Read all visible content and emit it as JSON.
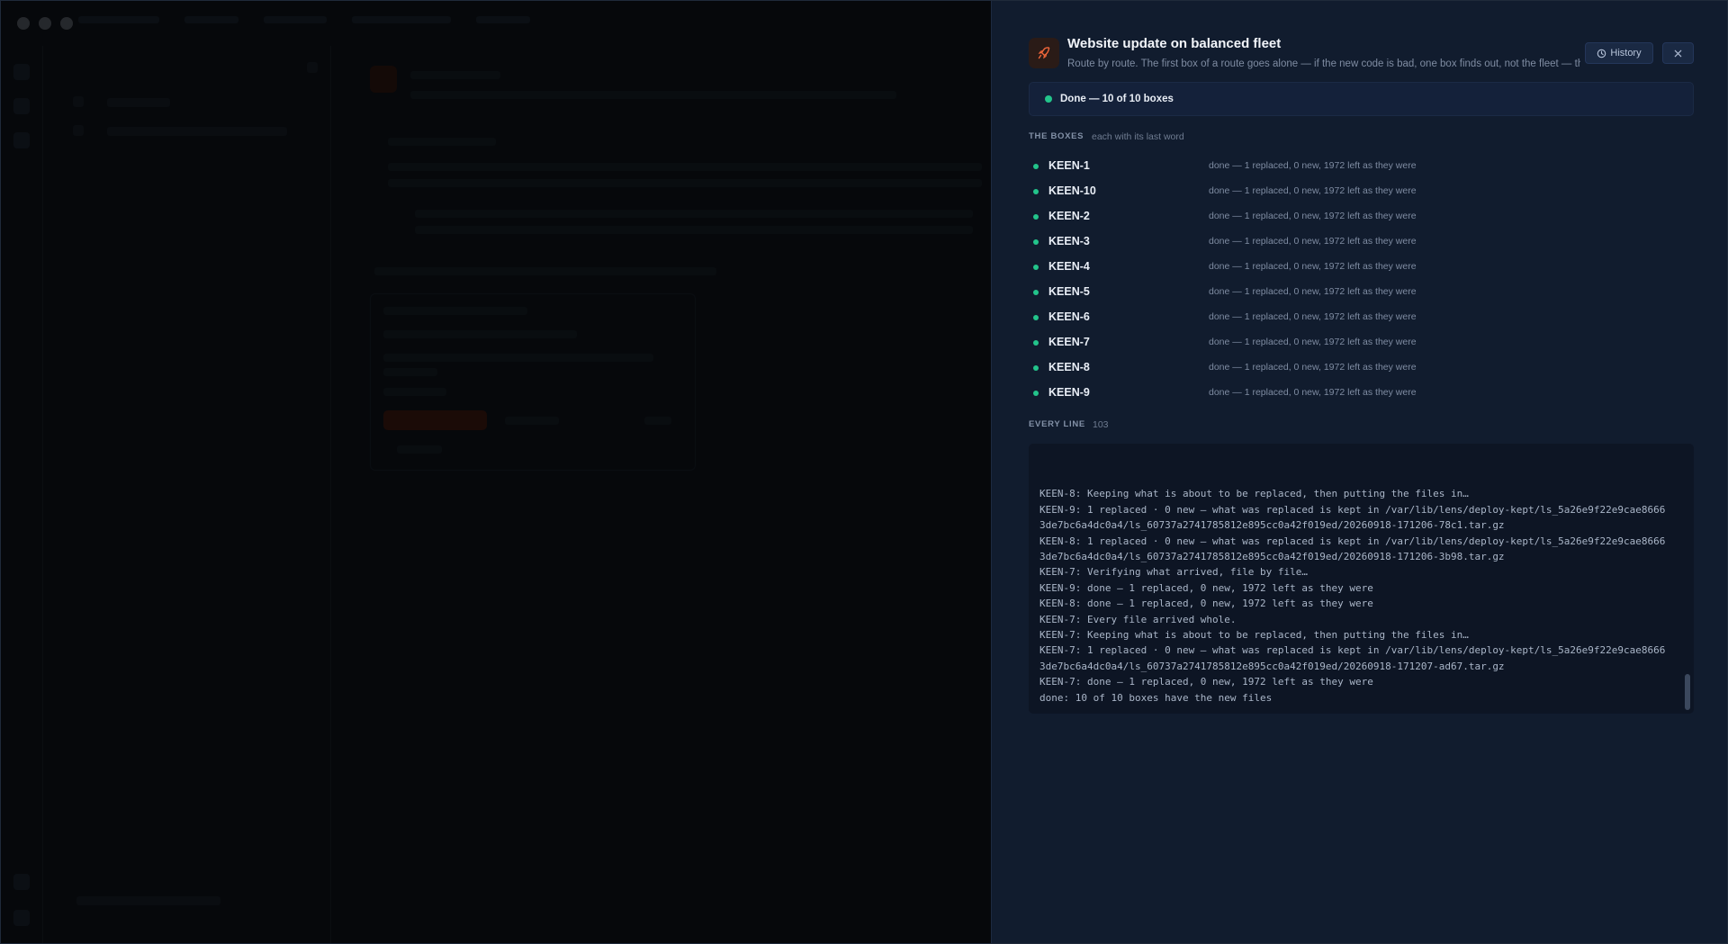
{
  "panel": {
    "title": "Website update on balanced fleet",
    "subtitle": "Route by route. The first box of a route goes alone — if the new code is bad, one box finds out, not the fleet — the",
    "history_label": "History",
    "icon": "rocket-icon",
    "close_icon": "close-icon",
    "status": {
      "text": "Done — 10 of 10 boxes",
      "color": "#23c48b"
    },
    "boxes_section": {
      "label": "THE BOXES",
      "sublabel": "each with its last word"
    },
    "boxes": [
      {
        "name": "KEEN-1",
        "note": "done — 1 replaced, 0 new, 1972 left as they were"
      },
      {
        "name": "KEEN-10",
        "note": "done — 1 replaced, 0 new, 1972 left as they were"
      },
      {
        "name": "KEEN-2",
        "note": "done — 1 replaced, 0 new, 1972 left as they were"
      },
      {
        "name": "KEEN-3",
        "note": "done — 1 replaced, 0 new, 1972 left as they were"
      },
      {
        "name": "KEEN-4",
        "note": "done — 1 replaced, 0 new, 1972 left as they were"
      },
      {
        "name": "KEEN-5",
        "note": "done — 1 replaced, 0 new, 1972 left as they were"
      },
      {
        "name": "KEEN-6",
        "note": "done — 1 replaced, 0 new, 1972 left as they were"
      },
      {
        "name": "KEEN-7",
        "note": "done — 1 replaced, 0 new, 1972 left as they were"
      },
      {
        "name": "KEEN-8",
        "note": "done — 1 replaced, 0 new, 1972 left as they were"
      },
      {
        "name": "KEEN-9",
        "note": "done — 1 replaced, 0 new, 1972 left as they were"
      }
    ],
    "lines_section": {
      "label": "EVERY LINE",
      "count": "103"
    },
    "log": [
      "KEEN-8: Keeping what is about to be replaced, then putting the files in…",
      "KEEN-9: 1 replaced · 0 new — what was replaced is kept in /var/lib/lens/deploy-kept/ls_5a26e9f22e9cae86663de7bc6a4dc0a4/ls_60737a2741785812e895cc0a42f019ed/20260918-171206-78c1.tar.gz",
      "KEEN-8: 1 replaced · 0 new — what was replaced is kept in /var/lib/lens/deploy-kept/ls_5a26e9f22e9cae86663de7bc6a4dc0a4/ls_60737a2741785812e895cc0a42f019ed/20260918-171206-3b98.tar.gz",
      "KEEN-7: Verifying what arrived, file by file…",
      "KEEN-9: done — 1 replaced, 0 new, 1972 left as they were",
      "KEEN-8: done — 1 replaced, 0 new, 1972 left as they were",
      "KEEN-7: Every file arrived whole.",
      "KEEN-7: Keeping what is about to be replaced, then putting the files in…",
      "KEEN-7: 1 replaced · 0 new — what was replaced is kept in /var/lib/lens/deploy-kept/ls_5a26e9f22e9cae86663de7bc6a4dc0a4/ls_60737a2741785812e895cc0a42f019ed/20260918-171207-ad67.tar.gz",
      "KEEN-7: done — 1 replaced, 0 new, 1972 left as they were",
      "done: 10 of 10 boxes have the new files"
    ]
  },
  "colors": {
    "accent_green": "#23c48b",
    "panel_bg": "#111c2e",
    "rocket_orange": "#f0663a"
  }
}
